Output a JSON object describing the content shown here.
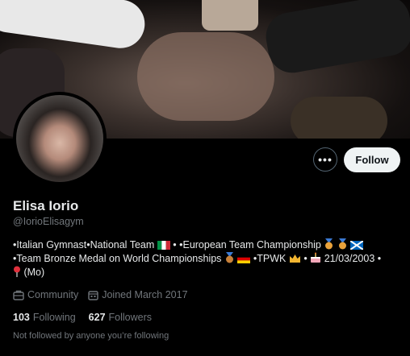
{
  "profile": {
    "name": "Elisa Iorio",
    "handle": "@IorioElisagym",
    "bio_line1_a": "•Italian Gymnast•National Team",
    "bio_line1_b": "• •European Team Championship",
    "bio_line2_a": "•Team Bronze Medal on World Championships",
    "bio_line2_b": "•TPWK",
    "bio_line2_c": "•",
    "bio_line2_d": "21/03/2003 •",
    "bio_line3": "(Mo)",
    "community_label": "Community",
    "joined_label": "Joined March 2017",
    "following_count": "103",
    "following_label": "Following",
    "followers_count": "627",
    "followers_label": "Followers",
    "not_followed_note": "Not followed by anyone you’re following"
  },
  "actions": {
    "more_label": "•••",
    "follow_label": "Follow"
  },
  "icons": {
    "more": "more-icon",
    "community": "community-icon",
    "calendar": "calendar-icon",
    "italy_flag": "italy-flag-icon",
    "medal": "medal-icon",
    "scotland_flag": "scotland-flag-icon",
    "germany_flag": "germany-flag-icon",
    "crown": "crown-icon",
    "cake": "cake-icon",
    "pin": "pin-icon"
  },
  "colors": {
    "background": "#000000",
    "text_primary": "#e7e9ea",
    "text_secondary": "#71767b",
    "follow_button_bg": "#eff3f4",
    "follow_button_text": "#0f1419"
  }
}
